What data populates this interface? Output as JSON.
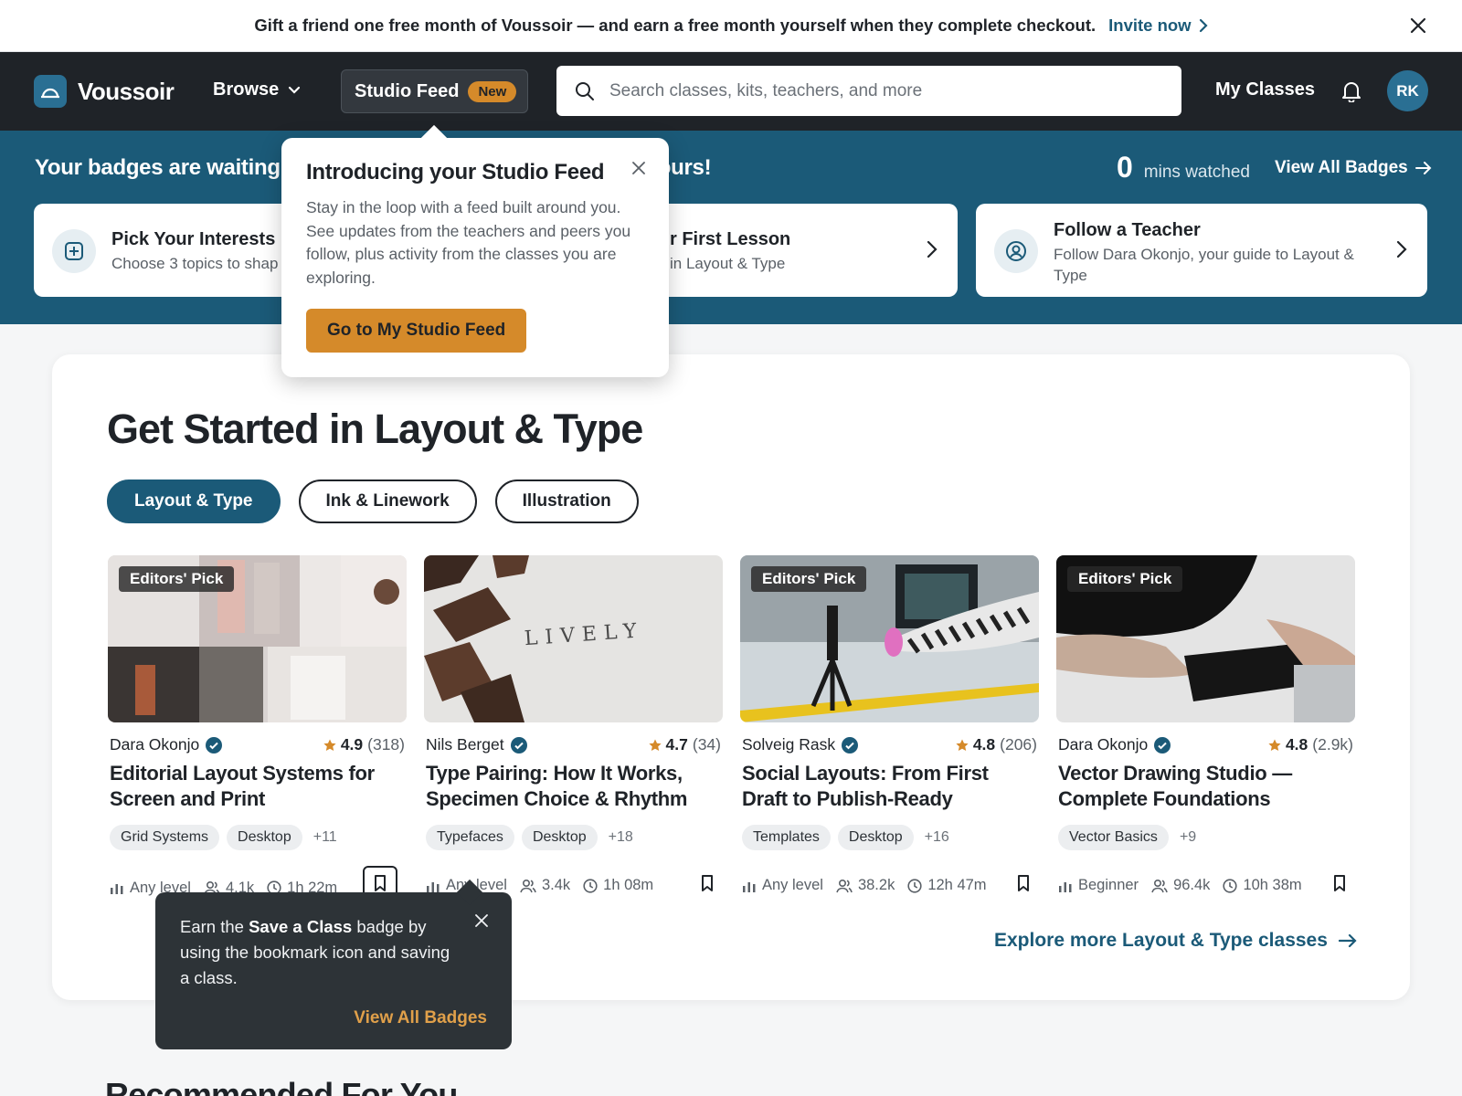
{
  "promo": {
    "message": "Gift a friend one free month of Voussoir — and earn a free month yourself when they complete checkout.",
    "link": "Invite now"
  },
  "header": {
    "brand": "Voussoir",
    "browse": "Browse",
    "studio_feed": "Studio Feed",
    "studio_badge": "New",
    "search_placeholder": "Search classes, kits, teachers, and more",
    "my_classes": "My Classes",
    "avatar_initials": "RK"
  },
  "badges": {
    "title_start": "Your badges are waiting",
    "title_end": "yours!",
    "mins_value": "0",
    "mins_label": "mins watched",
    "view_all": "View All Badges",
    "cards": [
      {
        "title": "Pick Your Interests",
        "subtitle": "Choose 3 topics to shap"
      },
      {
        "title": "r First Lesson",
        "subtitle": "in Layout & Type"
      },
      {
        "title": "Follow a Teacher",
        "subtitle": "Follow Dara Okonjo, your guide to Layout &",
        "subtitle2": "Type"
      }
    ]
  },
  "section": {
    "title": "Get Started in Layout & Type",
    "chips": [
      "Layout & Type",
      "Ink & Linework",
      "Illustration"
    ],
    "explore": "Explore more Layout & Type classes"
  },
  "cards": [
    {
      "badge": "Editors' Pick",
      "teacher": "Dara Okonjo",
      "rating": "4.9",
      "count": "(318)",
      "title": "Editorial Layout Systems for Screen and Print",
      "tags": [
        "Grid Systems",
        "Desktop"
      ],
      "more": "+11",
      "level": "Any level",
      "students": "4.1k",
      "duration": "1h 22m"
    },
    {
      "badge": "",
      "teacher": "Nils Berget",
      "rating": "4.7",
      "count": "(34)",
      "title": "Type Pairing: How It Works, Specimen Choice & Rhythm",
      "tags": [
        "Typefaces",
        "Desktop"
      ],
      "more": "+18",
      "level": "Any level",
      "students": "3.4k",
      "duration": "1h 08m",
      "image_text": "LIVELY"
    },
    {
      "badge": "Editors' Pick",
      "teacher": "Solveig Rask",
      "rating": "4.8",
      "count": "(206)",
      "title": "Social Layouts: From First Draft to Publish-Ready",
      "tags": [
        "Templates",
        "Desktop"
      ],
      "more": "+16",
      "level": "Any level",
      "students": "38.2k",
      "duration": "12h 47m"
    },
    {
      "badge": "Editors' Pick",
      "teacher": "Dara Okonjo",
      "rating": "4.8",
      "count": "(2.9k)",
      "title": "Vector Drawing Studio — Complete Foundations",
      "tags": [
        "Vector Basics"
      ],
      "more": "+9",
      "level": "Beginner",
      "students": "96.4k",
      "duration": "10h 38m"
    }
  ],
  "popover": {
    "title": "Introducing your Studio Feed",
    "body": "Stay in the loop with a feed built around you. See updates from the teachers and peers you follow, plus activity from the classes you are exploring.",
    "button": "Go to My Studio Feed"
  },
  "tooltip": {
    "pre": "Earn the ",
    "bold": "Save a Class",
    "post": " badge by using the bookmark icon and saving a class.",
    "link": "View All Badges"
  },
  "next_section": "Recommended For You",
  "colors": {
    "brand": "#1b5a78",
    "accent": "#d58a2a",
    "dark": "#1f2328"
  }
}
